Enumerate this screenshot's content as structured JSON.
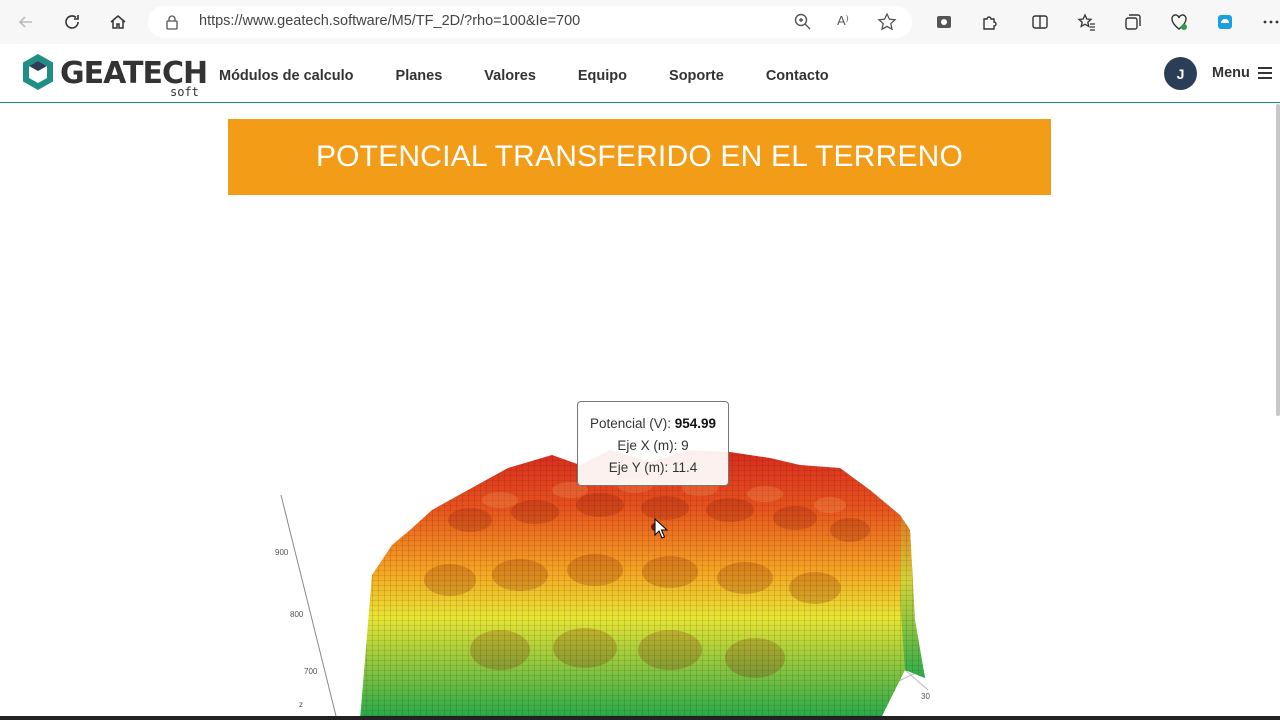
{
  "browser": {
    "url": "https://www.geatech.software/M5/TF_2D/?rho=100&Ie=700",
    "read_aloud_label": "A⁾"
  },
  "header": {
    "logo_text": "GEATECH",
    "logo_sub": "soft",
    "nav": [
      "Módulos de calculo",
      "Planes",
      "Valores",
      "Equipo",
      "Soporte",
      "Contacto"
    ],
    "avatar_initial": "J",
    "menu_label": "Menu"
  },
  "page": {
    "title": "POTENCIAL TRANSFERIDO EN EL TERRENO"
  },
  "plot": {
    "tooltip": {
      "z_label": "Potencial (V): ",
      "z_value": "954.99",
      "x_line": "Eje X (m): 9",
      "y_line": "Eje Y (m): 11.4"
    },
    "z_ticks": [
      "900",
      "800",
      "700",
      "z"
    ],
    "corner_tick": "30",
    "colorscale": [
      "#1fa84a",
      "#8cc63f",
      "#e8e534",
      "#f5a623",
      "#e8541e",
      "#d62a1e"
    ]
  }
}
